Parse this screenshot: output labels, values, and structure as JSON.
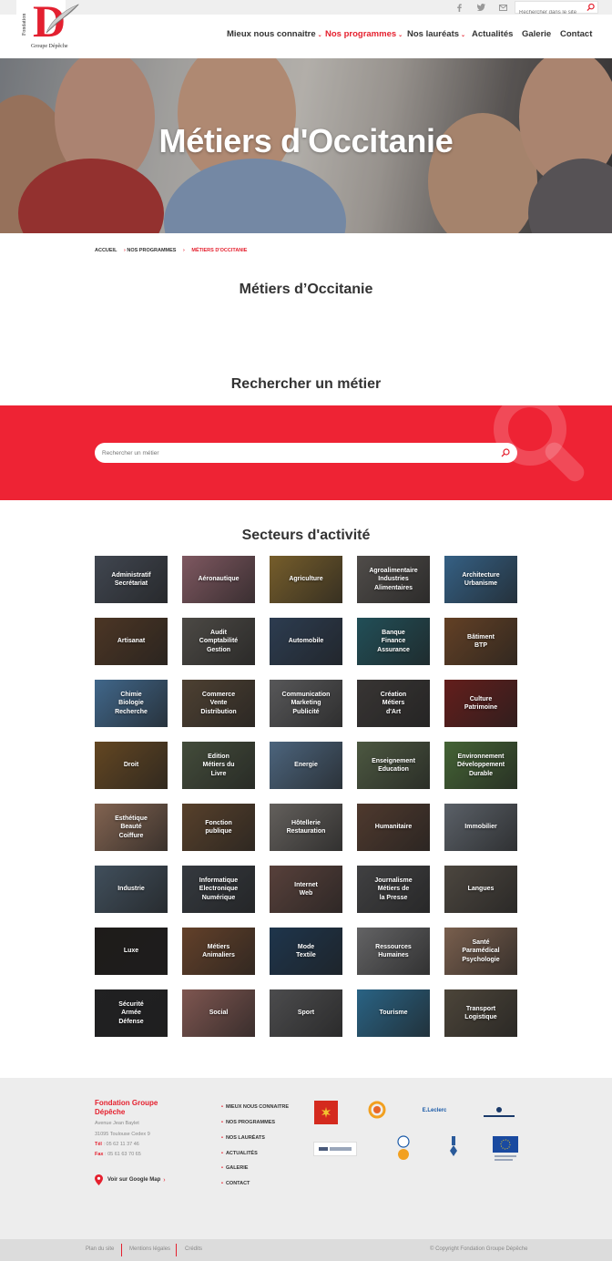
{
  "topbar": {
    "search_placeholder": "Rechercher dans le site",
    "social_icons": [
      "facebook-icon",
      "twitter-icon",
      "email-icon"
    ]
  },
  "logo": {
    "vertical_text": "Fondation",
    "letter": "D",
    "bottom_text": "Groupe Dépêche"
  },
  "nav": {
    "items": [
      {
        "label": "Mieux nous connaitre",
        "dropdown": true,
        "active": false
      },
      {
        "label": "Nos programmes",
        "dropdown": true,
        "active": true
      },
      {
        "label": "Nos lauréats",
        "dropdown": true,
        "active": false
      },
      {
        "label": "Actualités",
        "dropdown": false,
        "active": false
      },
      {
        "label": "Galerie",
        "dropdown": false,
        "active": false
      },
      {
        "label": "Contact",
        "dropdown": false,
        "active": false
      }
    ]
  },
  "hero": {
    "title": "Métiers d'Occitanie"
  },
  "breadcrumb": [
    "ACCUEIL",
    "NOS PROGRAMMES",
    "MÉTIERS D'OCCITANIE"
  ],
  "page_heading": "Métiers d’Occitanie",
  "search": {
    "heading": "Rechercher un métier",
    "placeholder": "Rechercher un métier"
  },
  "sectors": {
    "heading": "Secteurs d'activité",
    "items": [
      {
        "label": "Administratif\nSecrétariat",
        "bg": "#5a6270"
      },
      {
        "label": "Aéronautique",
        "bg": "#b07a86"
      },
      {
        "label": "Agriculture",
        "bg": "#a4823c"
      },
      {
        "label": "Agroalimentaire\nIndustries\nAlimentaires",
        "bg": "#6f6a66"
      },
      {
        "label": "Architecture\nUrbanisme",
        "bg": "#4a86b8"
      },
      {
        "label": "Artisanat",
        "bg": "#6a4b33"
      },
      {
        "label": "Audit\nComptabilité\nGestion",
        "bg": "#6a6660"
      },
      {
        "label": "Automobile",
        "bg": "#3e5470"
      },
      {
        "label": "Banque\nFinance\nAssurance",
        "bg": "#2f6e7a"
      },
      {
        "label": "Bâtiment\nBTP",
        "bg": "#8a5a34"
      },
      {
        "label": "Chimie\nBiologie\nRecherche",
        "bg": "#5a8fc0"
      },
      {
        "label": "Commerce\nVente\nDistribution",
        "bg": "#6c5a46"
      },
      {
        "label": "Communication\nMarketing\nPublicité",
        "bg": "#7a7a7c"
      },
      {
        "label": "Création\nMétiers\nd'Art",
        "bg": "#4e4a48"
      },
      {
        "label": "Culture\nPatrimoine",
        "bg": "#8a2a28"
      },
      {
        "label": "Droit",
        "bg": "#8a6230"
      },
      {
        "label": "Edition\nMétiers du\nLivre",
        "bg": "#5e6a52"
      },
      {
        "label": "Energie",
        "bg": "#6a8cae"
      },
      {
        "label": "Enseignement\nEducation",
        "bg": "#6a7a5a"
      },
      {
        "label": "Environnement\nDéveloppement\nDurable",
        "bg": "#5f8a4a"
      },
      {
        "label": "Esthétique\nBeauté\nCoiffure",
        "bg": "#b48a70"
      },
      {
        "label": "Fonction\npublique",
        "bg": "#7a5a3c"
      },
      {
        "label": "Hôtellerie\nRestauration",
        "bg": "#8a8580"
      },
      {
        "label": "Humanitaire",
        "bg": "#6e5040"
      },
      {
        "label": "Immobilier",
        "bg": "#7e8690"
      },
      {
        "label": "Industrie",
        "bg": "#5a6e80"
      },
      {
        "label": "Informatique\nElectronique\nNumérique",
        "bg": "#4a5058"
      },
      {
        "label": "Internet\nWeb",
        "bg": "#7a5a52"
      },
      {
        "label": "Journalisme\nMétiers de\nla Presse",
        "bg": "#5a5a5c"
      },
      {
        "label": "Langues",
        "bg": "#6a6258"
      },
      {
        "label": "Luxe",
        "bg": "#2a2624"
      },
      {
        "label": "Métiers\nAnimaliers",
        "bg": "#8a5a3a"
      },
      {
        "label": "Mode\nTextile",
        "bg": "#2a4a6a"
      },
      {
        "label": "Ressources\nHumaines",
        "bg": "#8a8a8c"
      },
      {
        "label": "Santé\nParamédical\nPsychologie",
        "bg": "#a8846c"
      },
      {
        "label": "Sécurité\nArmée\nDéfense",
        "bg": "#2e2e30"
      },
      {
        "label": "Social",
        "bg": "#b07870"
      },
      {
        "label": "Sport",
        "bg": "#6a6a6c"
      },
      {
        "label": "Tourisme",
        "bg": "#3a8ab8"
      },
      {
        "label": "Transport\nLogistique",
        "bg": "#6a6050"
      }
    ]
  },
  "footer": {
    "org_name": "Fondation Groupe Dépêche",
    "address1": "Avenue Jean Baylet",
    "address2": "31095 Toulouse Cedex 9",
    "tel_label": "Tél",
    "tel_value": " : 05 62 11 37 46",
    "fax_label": "Fax",
    "fax_value": " : 05 61 63 70 65",
    "map_link": "Voir sur Google Map",
    "menu": [
      "MIEUX NOUS CONNAITRE",
      "NOS PROGRAMMES",
      "NOS LAURÉATS",
      "ACTUALITÉS",
      "GALERIE",
      "CONTACT"
    ],
    "partners": [
      {
        "name": "Occitanie",
        "color": "#d42a1e"
      },
      {
        "name": "Harmonie mutuelle",
        "color": "#e8662a"
      },
      {
        "name": "E.Leclerc",
        "color": "#1a5aa8"
      },
      {
        "name": "Pierre Fabre",
        "color": "#1a3a6a"
      },
      {
        "name": "SDRO",
        "color": "#4a5a7a"
      },
      {
        "name": "Culture",
        "color": "#1a5aa8"
      },
      {
        "name": "Ordre",
        "color": "#2a5a9a"
      },
      {
        "name": "Union européenne",
        "color": "#1a4aa0"
      }
    ]
  },
  "bottombar": {
    "links": [
      "Plan du site",
      "Mentions légales",
      "Crédits"
    ],
    "copyright": "© Copyright Fondation Groupe Dépêche"
  },
  "colors": {
    "accent": "#e5202e",
    "band": "#ee2334"
  }
}
